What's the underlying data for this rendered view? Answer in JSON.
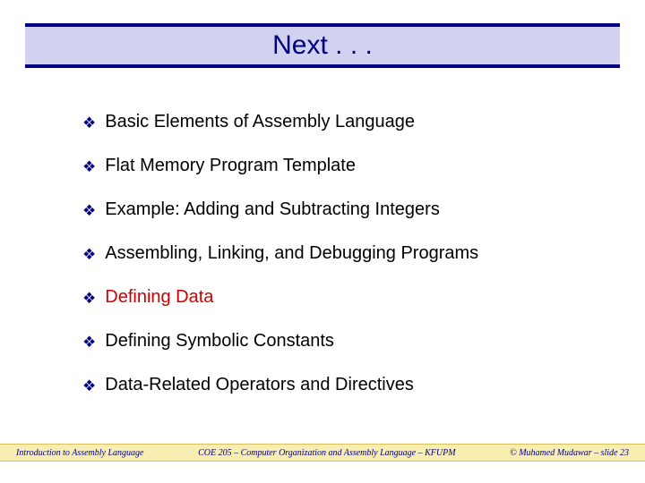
{
  "title": "Next . . .",
  "bullets": [
    {
      "text": "Basic Elements of Assembly Language",
      "highlight": false
    },
    {
      "text": "Flat Memory Program Template",
      "highlight": false
    },
    {
      "text": "Example: Adding and Subtracting Integers",
      "highlight": false
    },
    {
      "text": "Assembling, Linking, and Debugging Programs",
      "highlight": false
    },
    {
      "text": "Defining Data",
      "highlight": true
    },
    {
      "text": "Defining Symbolic Constants",
      "highlight": false
    },
    {
      "text": "Data-Related Operators and Directives",
      "highlight": false
    }
  ],
  "footer": {
    "left": "Introduction to Assembly Language",
    "center": "COE 205 – Computer Organization and Assembly Language – KFUPM",
    "right": "© Muhamed Mudawar – slide 23"
  }
}
